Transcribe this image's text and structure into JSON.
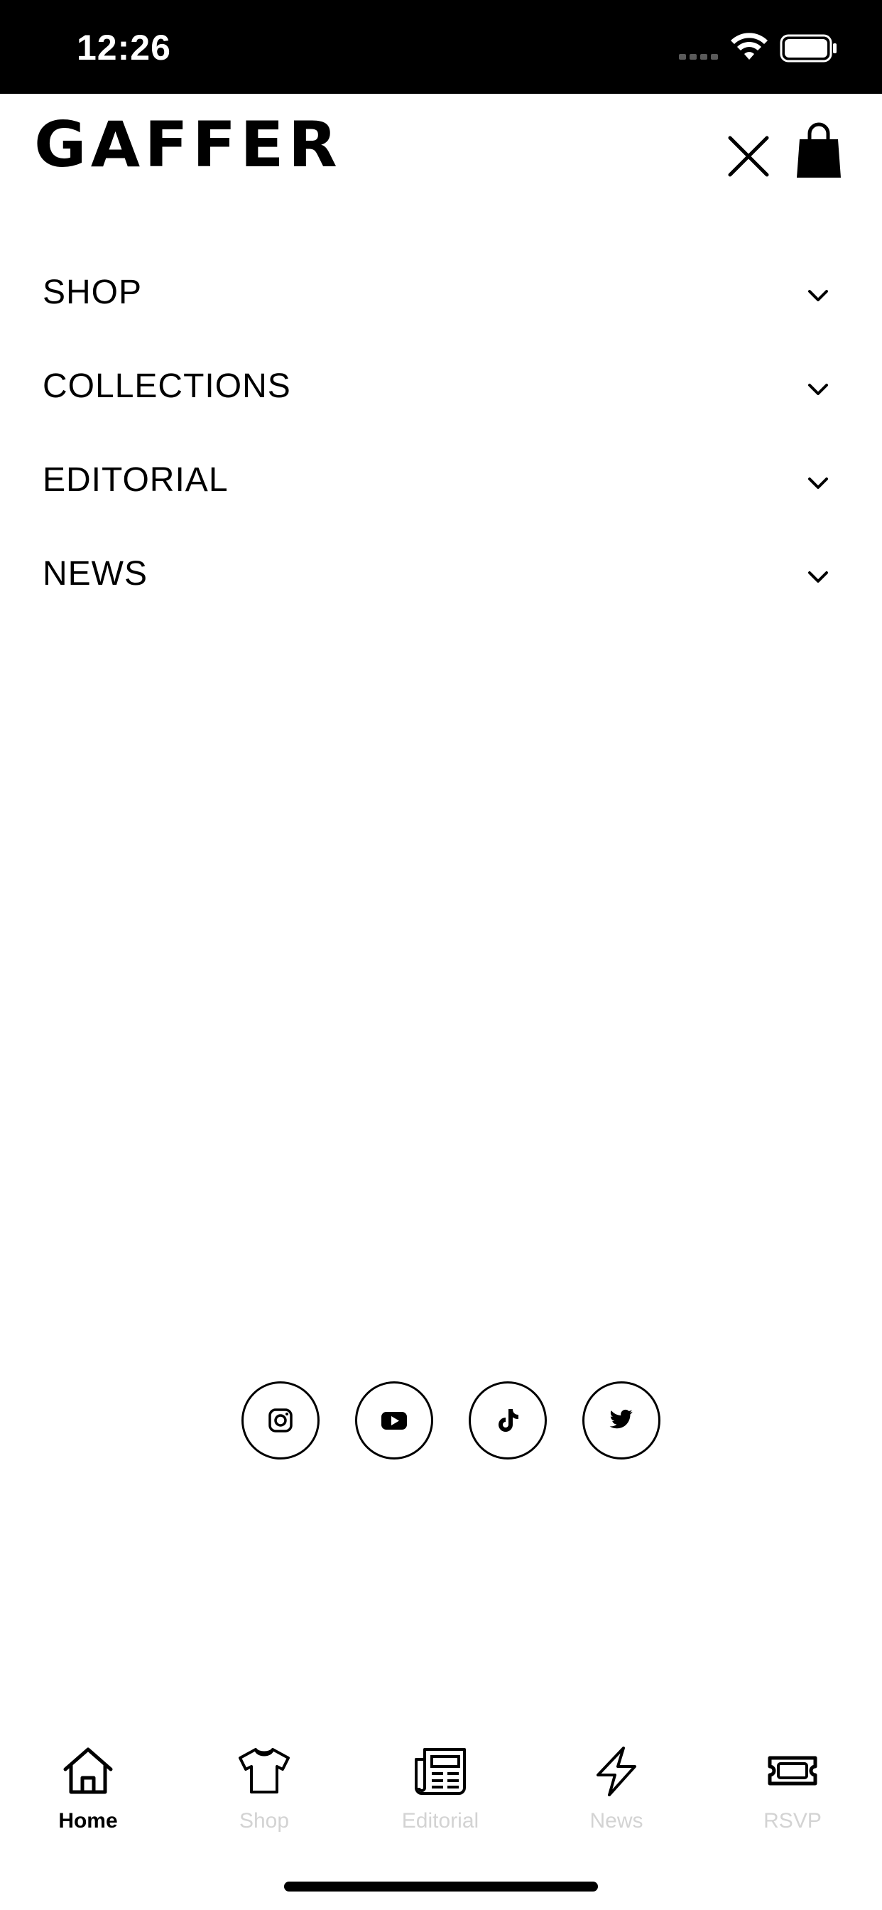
{
  "status_bar": {
    "time": "12:26"
  },
  "header": {
    "brand": "GAFFER"
  },
  "menu": {
    "items": [
      {
        "label": "SHOP"
      },
      {
        "label": "COLLECTIONS"
      },
      {
        "label": "EDITORIAL"
      },
      {
        "label": "NEWS"
      }
    ]
  },
  "social": [
    "instagram-icon",
    "youtube-icon",
    "tiktok-icon",
    "twitter-icon"
  ],
  "tabbar": {
    "tabs": [
      {
        "label": "Home",
        "active": true
      },
      {
        "label": "Shop",
        "active": false
      },
      {
        "label": "Editorial",
        "active": false
      },
      {
        "label": "News",
        "active": false
      },
      {
        "label": "RSVP",
        "active": false
      }
    ]
  },
  "colors": {
    "status_bar_bg": "#000000",
    "active_tab": "#000000",
    "inactive_tab": "#d3d3d3"
  }
}
